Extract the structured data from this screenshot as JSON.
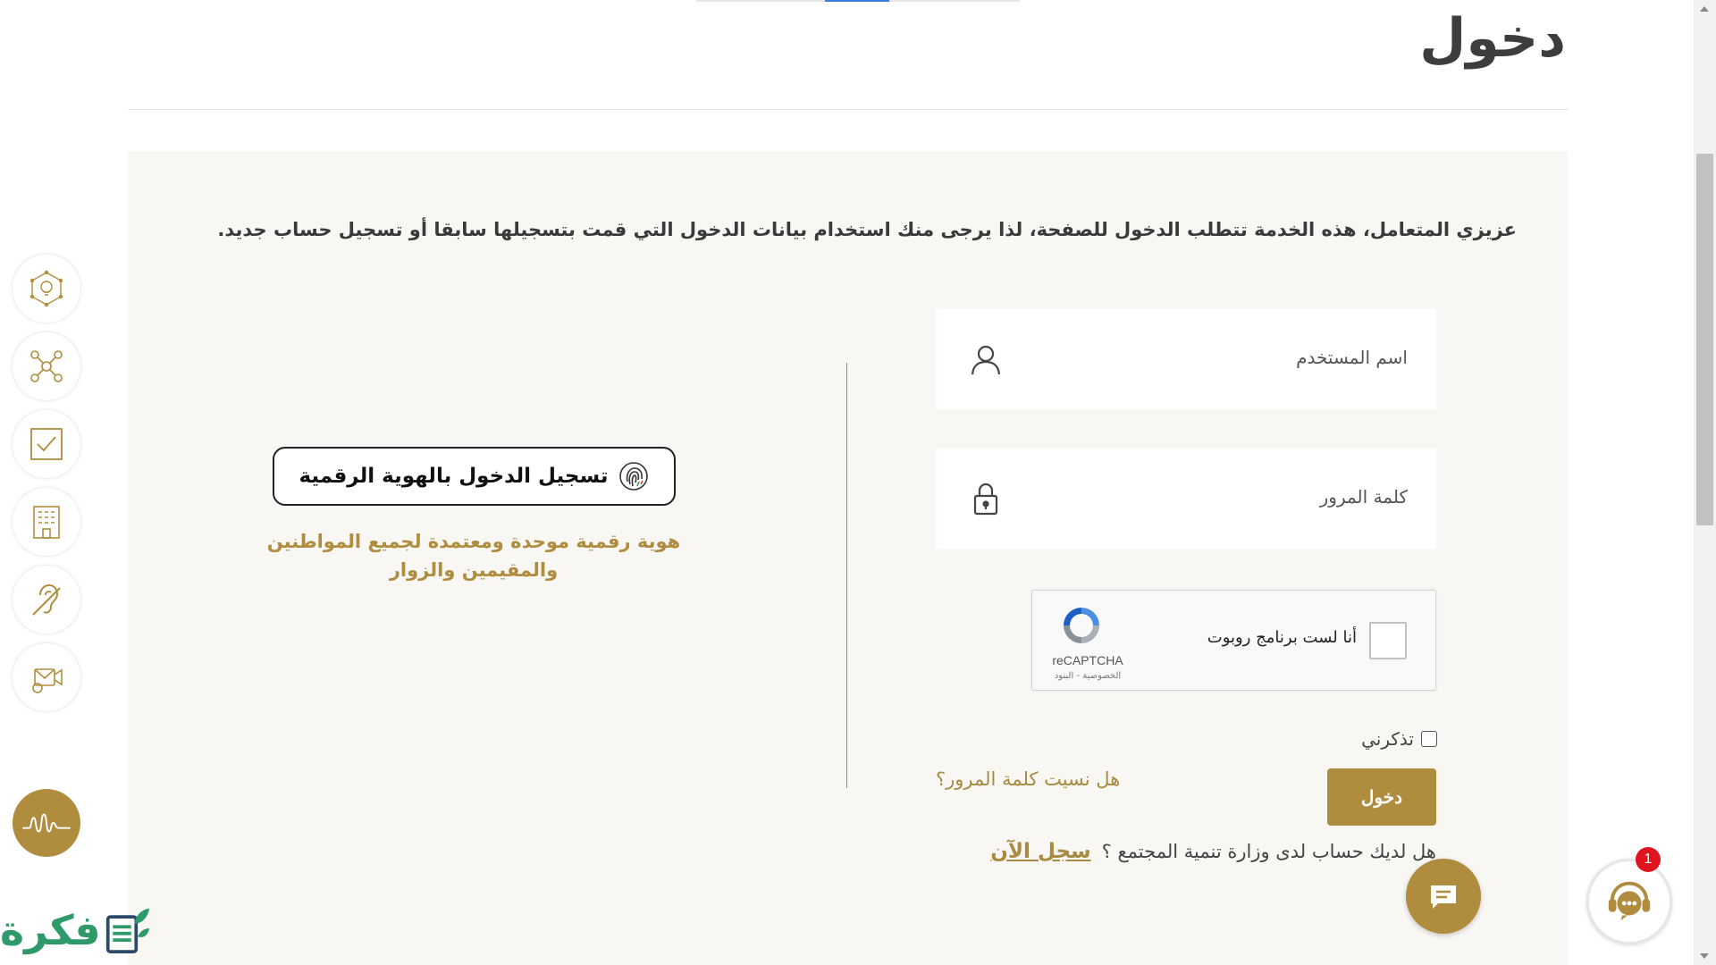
{
  "page": {
    "title": "دخول"
  },
  "intro": "عزيزي المتعامل، هذه الخدمة تتطلب الدخول للصفحة، لذا يرجى منك استخدام بيانات الدخول التي قمت بتسجيلها سابقا أو تسجيل حساب جديد.",
  "form": {
    "username_placeholder": "اسم المستخدم",
    "password_placeholder": "كلمة المرور",
    "remember_label": "تذكرني",
    "login_label": "دخول",
    "forgot_label": "هل نسيت كلمة المرور؟",
    "register_question": "هل لديك حساب لدى وزارة تنمية المجتمع ؟",
    "register_link": "سجل الآن"
  },
  "captcha": {
    "label": "أنا لست برنامج روبوت",
    "brand": "reCAPTCHA",
    "terms": "الخصوصية - البنود"
  },
  "uaepass": {
    "button_label": "تسجيل الدخول بالهوية الرقمية",
    "description": "هوية رقمية موحدة ومعتمدة لجميع المواطنين والمقيمين والزوار"
  },
  "support": {
    "badge_count": "1"
  },
  "watermark": {
    "text": "فكرة"
  },
  "colors": {
    "accent": "#b08d3e",
    "panel": "#f8f7f4",
    "badge": "#e0141e"
  }
}
